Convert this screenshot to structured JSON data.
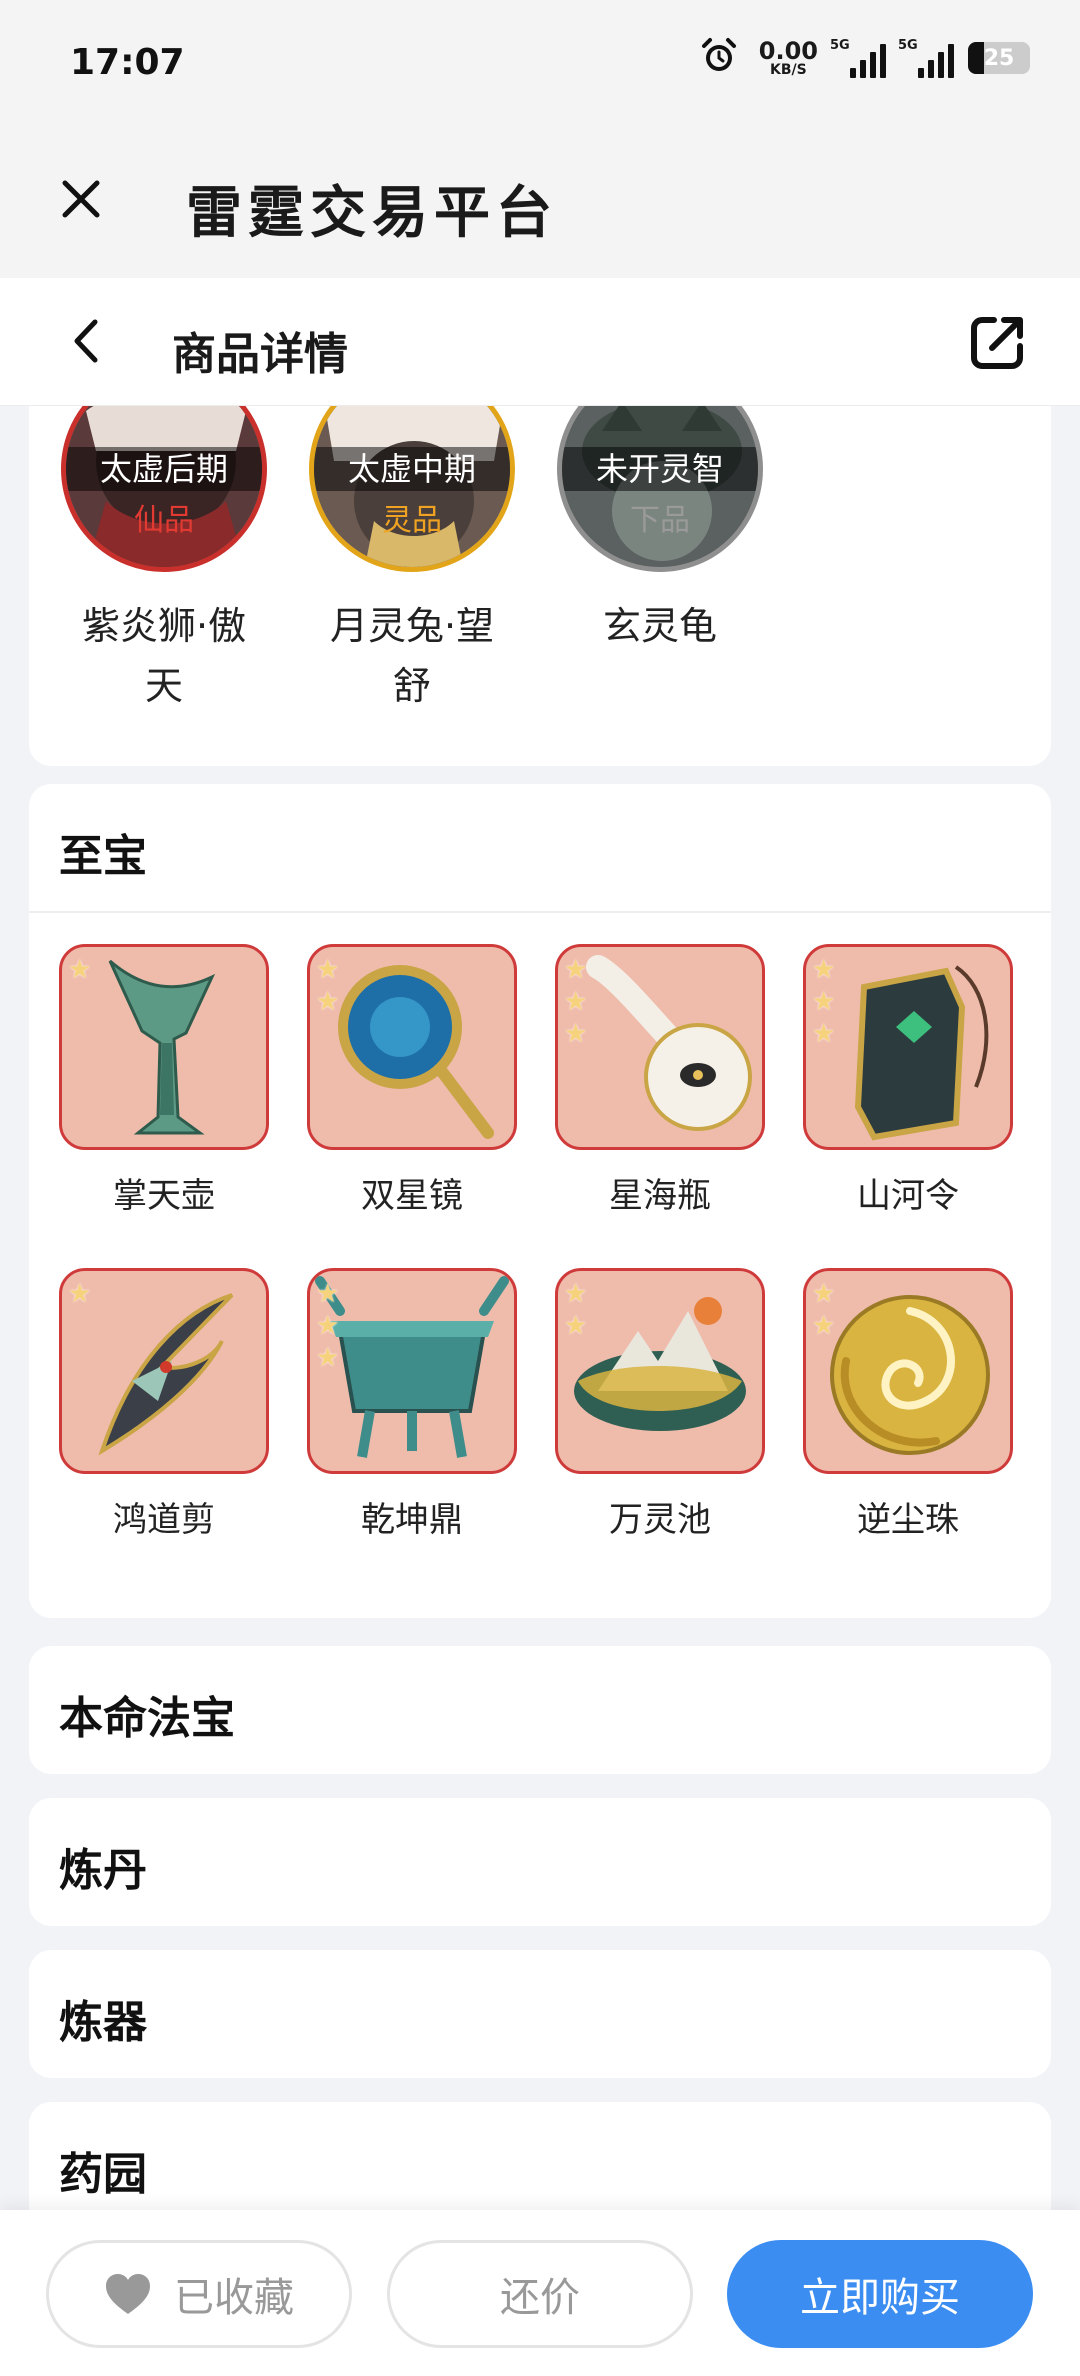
{
  "status_bar": {
    "time": "17:07",
    "net_speed_value": "0.00",
    "net_speed_unit": "KB/S",
    "signal_1_label": "5G",
    "signal_2_label": "5G",
    "battery_level": "25",
    "icons": [
      "alarm-icon",
      "signal-icon",
      "battery-icon"
    ]
  },
  "app_bar": {
    "title": "雷霆交易平台",
    "close_icon": "close-icon"
  },
  "sub_bar": {
    "title": "商品详情",
    "back_icon": "chevron-left-icon",
    "share_icon": "share-external-icon"
  },
  "pets": [
    {
      "stage": "太虚后期",
      "grade": "仙品",
      "name": "紫炎狮·傲天",
      "grade_color": "#e03a32",
      "frame": "red"
    },
    {
      "stage": "太虚中期",
      "grade": "灵品",
      "name": "月灵兔·望舒",
      "grade_color": "#f0a322",
      "frame": "gold"
    },
    {
      "stage": "未开灵智",
      "grade": "下品",
      "name": "玄灵龟",
      "grade_color": "#9a9a9a",
      "frame": "gray"
    }
  ],
  "treasure_section": {
    "title": "至宝",
    "items": [
      {
        "name": "掌天壶",
        "stars": 1,
        "icon": "bronze-blade-icon"
      },
      {
        "name": "双星镜",
        "stars": 2,
        "icon": "hand-mirror-icon"
      },
      {
        "name": "星海瓶",
        "stars": 3,
        "icon": "porcelain-ladle-icon"
      },
      {
        "name": "山河令",
        "stars": 3,
        "icon": "jade-token-icon"
      },
      {
        "name": "鸿道剪",
        "stars": 1,
        "icon": "curved-blade-icon"
      },
      {
        "name": "乾坤鼎",
        "stars": 3,
        "icon": "bronze-cauldron-icon"
      },
      {
        "name": "万灵池",
        "stars": 2,
        "icon": "mountain-pool-icon"
      },
      {
        "name": "逆尘珠",
        "stars": 2,
        "icon": "golden-orb-icon"
      }
    ]
  },
  "sections": [
    {
      "title": "本命法宝"
    },
    {
      "title": "炼丹"
    },
    {
      "title": "炼器"
    },
    {
      "title": "药园"
    }
  ],
  "bottom_bar": {
    "favorite_label": "已收藏",
    "favorite_icon": "heart-icon",
    "offer_label": "还价",
    "buy_label": "立即购买"
  },
  "colors": {
    "accent": "#3b8df2",
    "item_bg": "#efbcac",
    "item_border": "#cf3b3b",
    "star": "#f6d27c"
  }
}
